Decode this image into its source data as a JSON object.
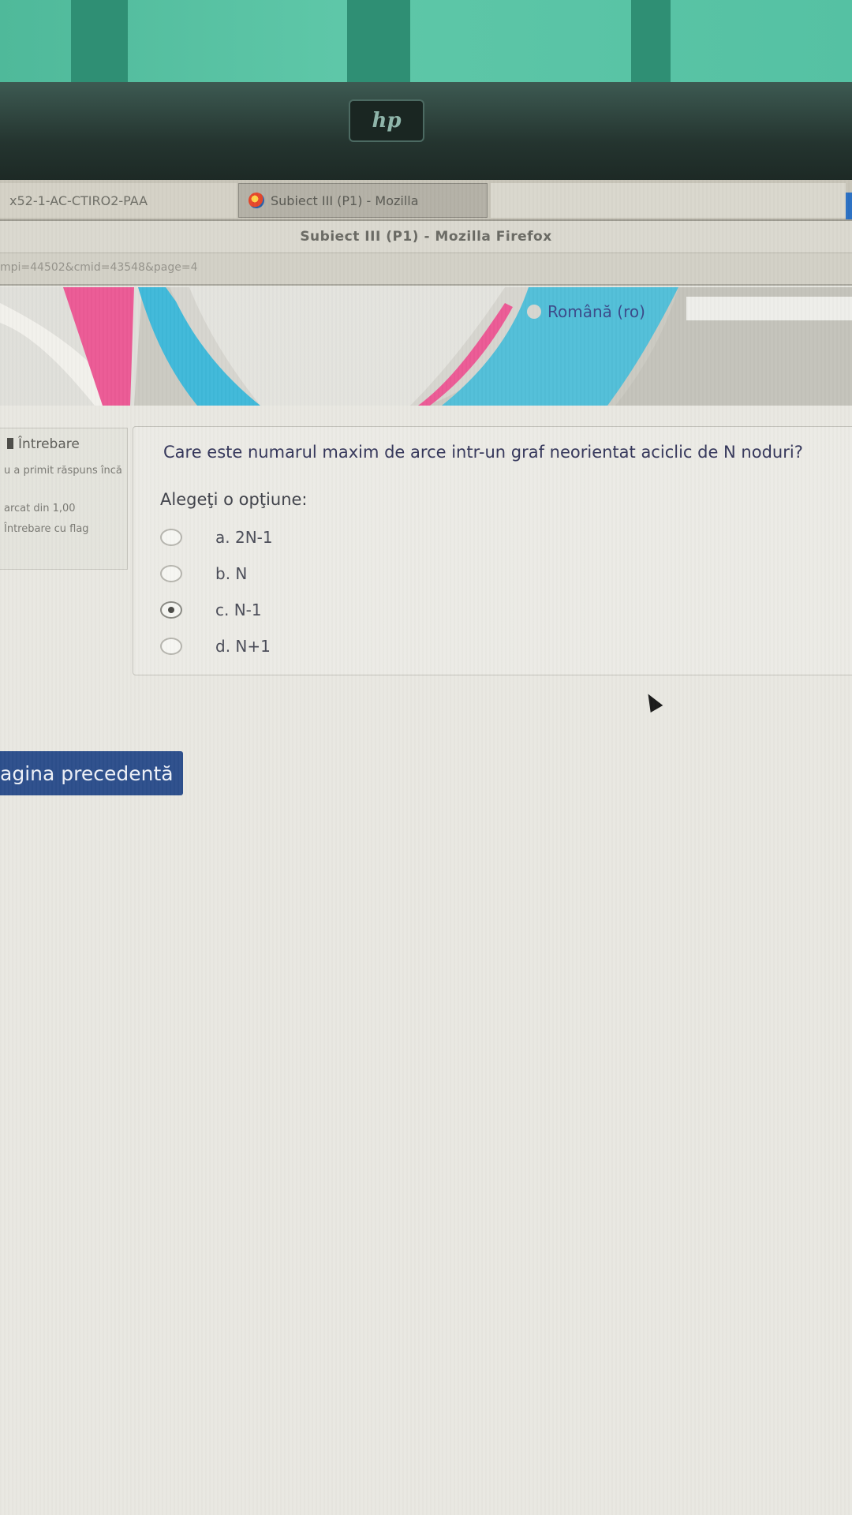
{
  "browser": {
    "tabs": [
      {
        "label": "x52-1-AC-CTIRO2-PAA"
      },
      {
        "label": "Subiect III (P1) - Mozilla"
      },
      {
        "label": ""
      }
    ],
    "window_title": "Subiect III (P1) - Mozilla Firefox",
    "url": "mpi=44502&cmid=43548&page=4"
  },
  "monitor": {
    "brand_logo": "hp"
  },
  "header": {
    "language": "Română (ro)"
  },
  "question_info": {
    "title": "Întrebare",
    "status": "u a primit răspuns încă",
    "mark": "arcat din 1,00",
    "flag_label": "Întrebare cu flag"
  },
  "question": {
    "text": "Care este numarul maxim de arce intr-un graf neorientat aciclic de N noduri?",
    "prompt": "Alegeţi o opţiune:",
    "options": [
      {
        "label": "a. 2N-1",
        "selected": false
      },
      {
        "label": "b. N",
        "selected": false
      },
      {
        "label": "c. N-1",
        "selected": true
      },
      {
        "label": "d. N+1",
        "selected": false
      }
    ]
  },
  "navigation": {
    "prev_label": "agina precedentă"
  },
  "colors": {
    "accent_button": "#2d4f8c",
    "banner_pink": "#ec5a95",
    "banner_cyan": "#3fb9d9",
    "wall": "#55c1a3"
  }
}
